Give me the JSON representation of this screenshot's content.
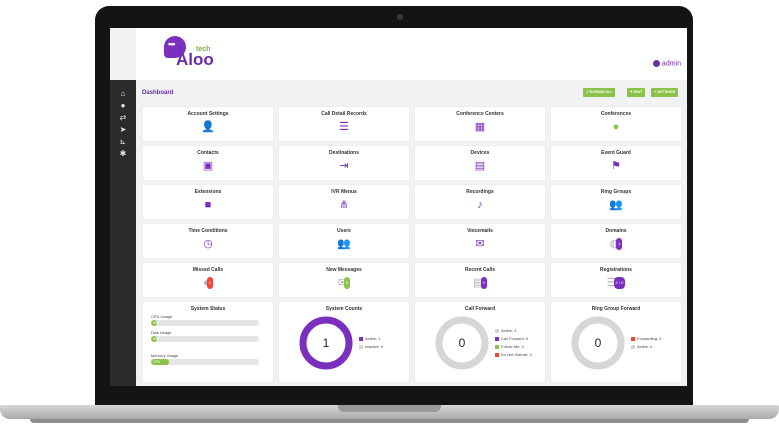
{
  "header": {
    "logo_text": "Aloo",
    "logo_sub": "tech",
    "user": "admin"
  },
  "sidebar": {
    "icons": [
      "home-icon",
      "user-icon",
      "transfer-icon",
      "send-icon",
      "chart-icon",
      "gear-icon"
    ]
  },
  "page": {
    "title": "Dashboard",
    "expand_label": "EXPAND ALL",
    "edit_label": "EDIT",
    "settings_label": "SETTINGS"
  },
  "cards": [
    {
      "label": "Account Settings",
      "icon": "user-cog-icon"
    },
    {
      "label": "Call Detail Records",
      "icon": "list-icon"
    },
    {
      "label": "Conference Centers",
      "icon": "building-icon"
    },
    {
      "label": "Conferences",
      "icon": "comments-icon"
    },
    {
      "label": "Contacts",
      "icon": "address-card-icon"
    },
    {
      "label": "Destinations",
      "icon": "sign-in-icon"
    },
    {
      "label": "Devices",
      "icon": "phone-device-icon"
    },
    {
      "label": "Event Guard",
      "icon": "guard-icon"
    },
    {
      "label": "Extensions",
      "icon": "briefcase-icon"
    },
    {
      "label": "IVR Menus",
      "icon": "sitemap-icon"
    },
    {
      "label": "Recordings",
      "icon": "microphone-icon"
    },
    {
      "label": "Ring Groups",
      "icon": "users-icon"
    },
    {
      "label": "Time Conditions",
      "icon": "clock-icon"
    },
    {
      "label": "Users",
      "icon": "user-friends-icon"
    },
    {
      "label": "Voicemails",
      "icon": "envelope-icon"
    },
    {
      "label": "Domains",
      "icon": "globe-icon"
    },
    {
      "label": "Missed Calls",
      "icon": "missed-call-icon"
    },
    {
      "label": "New Messages",
      "icon": "message-icon"
    },
    {
      "label": "Recent Calls",
      "icon": "recent-calls-icon"
    },
    {
      "label": "Registrations",
      "icon": "registrations-icon",
      "badge": "2 / 0"
    }
  ],
  "domains_badge": "1",
  "missed_badge": "0",
  "messages_badge": "0",
  "recent_badge": "0",
  "system_status": {
    "title": "System Status",
    "cpu": {
      "label": "CPU Usage",
      "value": "0%",
      "fraction": 0.02
    },
    "disk": {
      "label": "Disk Usage",
      "value": "0%",
      "fraction": 0.02
    },
    "memory": {
      "label": "Memory Usage",
      "value": "17%",
      "fraction": 0.17
    }
  },
  "system_counts": {
    "title": "System Counts",
    "center": "1",
    "active": "Active: 1",
    "inactive": "Inactive: 0"
  },
  "call_forward": {
    "title": "Call Forward",
    "center": "0",
    "active": "Active: 3",
    "forward": "Call Forward: 0",
    "follow": "Follow Me: 0",
    "dnd": "Do Not Disturb: 0"
  },
  "ring_group_forward": {
    "title": "Ring Group Forward",
    "center": "0",
    "forwarding": "Forwarding: 0",
    "active": "Active: 0"
  },
  "colors": {
    "accent": "#7b2fbf",
    "green": "#8bc34a",
    "red": "#f44336",
    "gray": "#d6d6d6"
  }
}
